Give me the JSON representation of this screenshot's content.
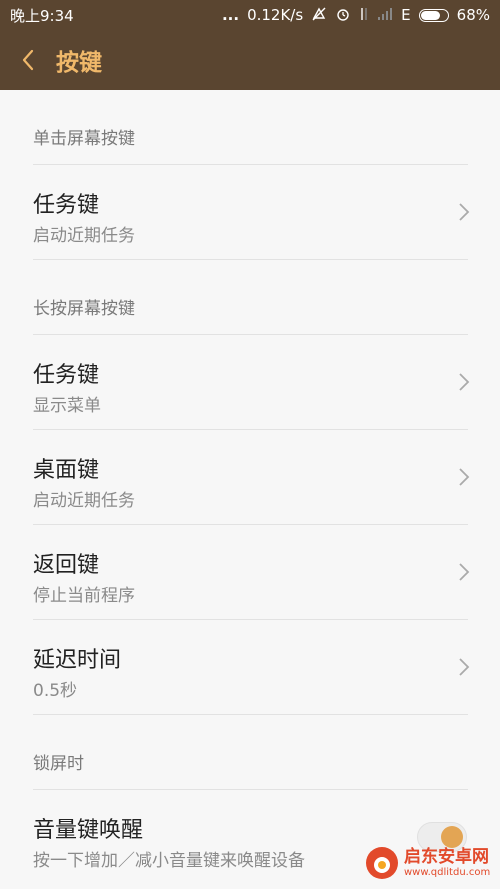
{
  "status_bar": {
    "time": "晚上9:34",
    "dots": "...",
    "speed": "0.12K/s",
    "network": "E",
    "battery": "68%"
  },
  "app_bar": {
    "title": "按键"
  },
  "sections": [
    {
      "header": "单击屏幕按键",
      "rows": [
        {
          "title": "任务键",
          "subtitle": "启动近期任务"
        }
      ]
    },
    {
      "header": "长按屏幕按键",
      "rows": [
        {
          "title": "任务键",
          "subtitle": "显示菜单"
        },
        {
          "title": "桌面键",
          "subtitle": "启动近期任务"
        },
        {
          "title": "返回键",
          "subtitle": "停止当前程序"
        },
        {
          "title": "延迟时间",
          "subtitle": "0.5秒"
        }
      ]
    },
    {
      "header": "锁屏时",
      "rows": [
        {
          "title": "音量键唤醒",
          "subtitle": "按一下增加／减小音量键来唤醒设备",
          "toggle_on": true
        }
      ]
    }
  ],
  "watermark": {
    "title": "启东安卓网",
    "url": "www.qdlitdu.com"
  },
  "colors": {
    "header_bg": "#5a4530",
    "title": "#f0b86a",
    "accent": "#e3a554"
  }
}
